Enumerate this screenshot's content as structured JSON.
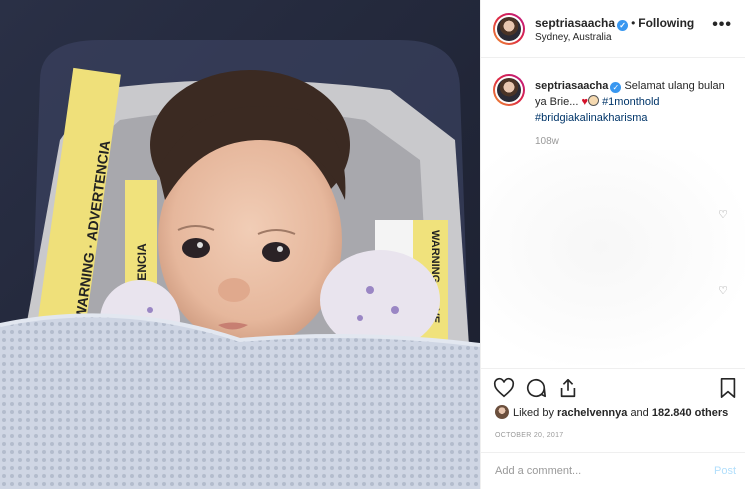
{
  "post": {
    "photo_alt": "Baby in car seat under knitted blanket",
    "seat_labels": {
      "left_warning": "WARNING · ADVERTENCIA",
      "mid_warning": "ADVERTENCIA",
      "right_warning": "WARNING · ADVE"
    }
  },
  "header": {
    "username": "septriasaacha",
    "separator": "•",
    "follow_status": "Following",
    "location": "Sydney, Australia",
    "more_label": "•••"
  },
  "caption": {
    "username": "septriasaacha",
    "text_part1": "Selamat ulang bulan ya Brie...",
    "heart": "♥",
    "hashtag1": "#1monthold",
    "hashtag2": "#bridgiakalinakharisma",
    "time_ago": "108w"
  },
  "likes": {
    "liked_by_prefix": "Liked by",
    "liked_by_user": "rachelvennya",
    "and_text": "and",
    "others": "182.840 others"
  },
  "date": "OCTOBER 20, 2017",
  "comment": {
    "placeholder": "Add a comment...",
    "post_label": "Post"
  },
  "colors": {
    "accent": "#3897f0",
    "hashtag": "#003569",
    "heart": "#d4122a",
    "post_disabled": "#b2dffc"
  },
  "icons": [
    "heart-icon",
    "comment-icon",
    "share-icon",
    "bookmark-icon",
    "more-icon",
    "verified-icon"
  ]
}
